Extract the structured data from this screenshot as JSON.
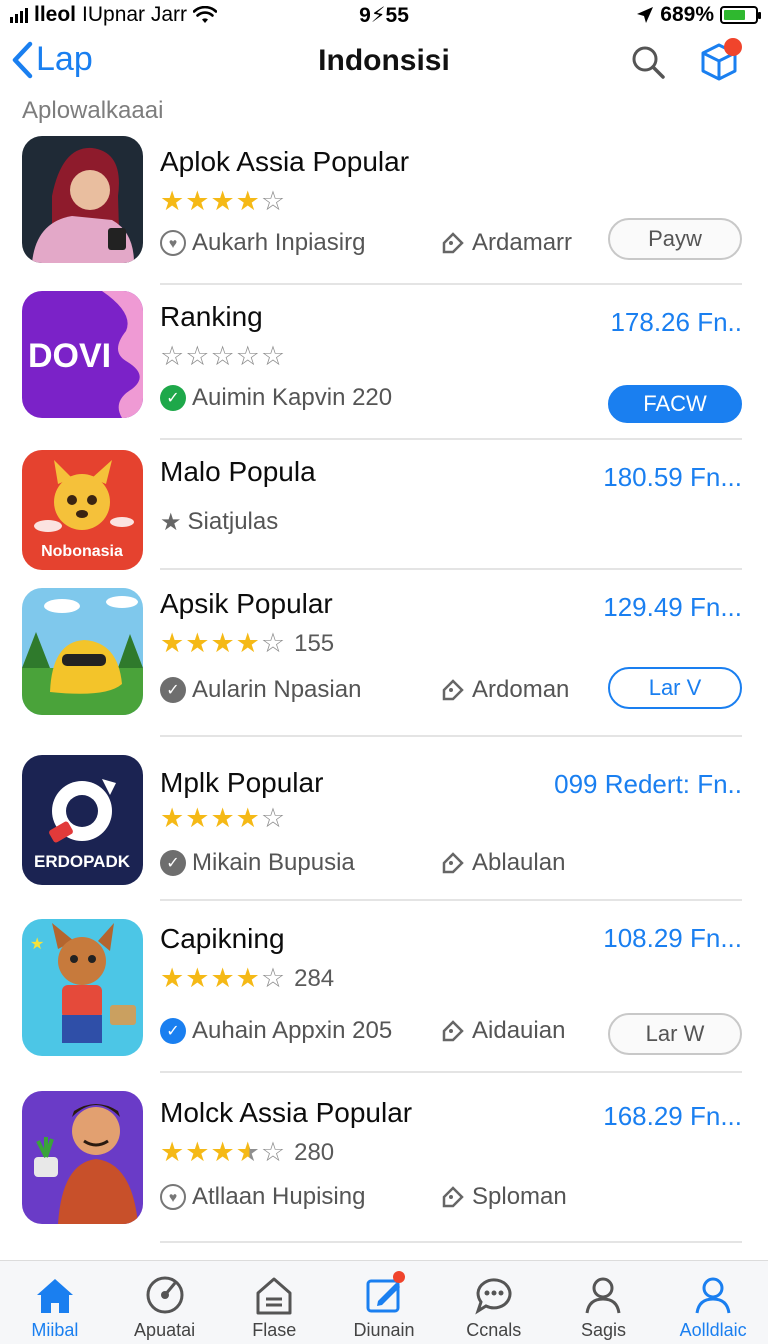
{
  "status_bar": {
    "carrier": "IUpnar Jarr",
    "signal_label": "lleol",
    "time": "9⚡55",
    "battery": "689%",
    "battery_level": 0.69
  },
  "nav": {
    "back_label": "Lap",
    "title": "Indonsisi"
  },
  "section_label": "Aplowalkaaai",
  "apps": [
    {
      "name": "Aplok Assia Popular",
      "price": "",
      "stars": 4,
      "half": false,
      "rating_count": "",
      "meta_a": "Aukarh Inpiasirg",
      "meta_a_icon": "heart-icon",
      "meta_b": "Ardamarr",
      "button": "Payw",
      "button_style": "gray",
      "icon_label": ""
    },
    {
      "name": "Ranking",
      "price": "178.26 Fn..",
      "stars": 0,
      "half": false,
      "rating_count": "",
      "meta_a": "Auimin Kapvin 220",
      "meta_a_icon": "check-green-icon",
      "meta_b": "",
      "button": "FAСW",
      "button_style": "blue",
      "icon_label": "DOVI"
    },
    {
      "name": "Malo Popula",
      "price": "180.59 Fn...",
      "stars": -1,
      "half": false,
      "rating_count": "",
      "meta_a": "Siatjulas",
      "meta_a_icon": "star-icon",
      "meta_b": "",
      "button": "",
      "button_style": "",
      "icon_label": "Nobonasia"
    },
    {
      "name": "Apsik Popular",
      "price": "129.49 Fn...",
      "stars": 4,
      "half": false,
      "rating_count": "155",
      "meta_a": "Aularin Npasian",
      "meta_a_icon": "check-gray-icon",
      "meta_b": "Ardoman",
      "button": "Lar V",
      "button_style": "outline",
      "icon_label": ""
    },
    {
      "name": "Mplk Popular",
      "price": "099 Redert: Fn..",
      "stars": 4,
      "half": false,
      "rating_count": "",
      "meta_a": "Mikain Bupusia",
      "meta_a_icon": "check-gray-icon",
      "meta_b": "Ablaulan",
      "button": "",
      "button_style": "",
      "icon_label": "ERDOPADK"
    },
    {
      "name": "Capikning",
      "price": "108.29 Fn...",
      "stars": 4,
      "half": false,
      "rating_count": "284",
      "meta_a": "Auhain Appxin 205",
      "meta_a_icon": "check-blue-icon",
      "meta_b": "Aidauian",
      "button": "Lar W",
      "button_style": "gray",
      "icon_label": ""
    },
    {
      "name": "Molck Assia Popular",
      "price": "168.29 Fn...",
      "stars": 3,
      "half": true,
      "rating_count": "280",
      "meta_a": "Atllaan Hupising",
      "meta_a_icon": "heart-icon",
      "meta_b": "Sploman",
      "button": "",
      "button_style": "",
      "icon_label": ""
    }
  ],
  "tabs": [
    {
      "label": "Miibal",
      "icon": "home-icon",
      "active": true
    },
    {
      "label": "Apuatai",
      "icon": "disc-icon",
      "active": false
    },
    {
      "label": "Flase",
      "icon": "house-outline-icon",
      "active": false
    },
    {
      "label": "Diunain",
      "icon": "edit-square-icon",
      "active": false,
      "dot": true
    },
    {
      "label": "Ccnals",
      "icon": "chat-bubble-icon",
      "active": false
    },
    {
      "label": "Sagis",
      "icon": "person-icon",
      "active": false
    },
    {
      "label": "Aolldlaic",
      "icon": "person-icon",
      "active": true
    }
  ],
  "colors": {
    "accent": "#1a7ff0",
    "star": "#f5b916",
    "badge": "#f0442c",
    "battery": "#2fb82f"
  }
}
